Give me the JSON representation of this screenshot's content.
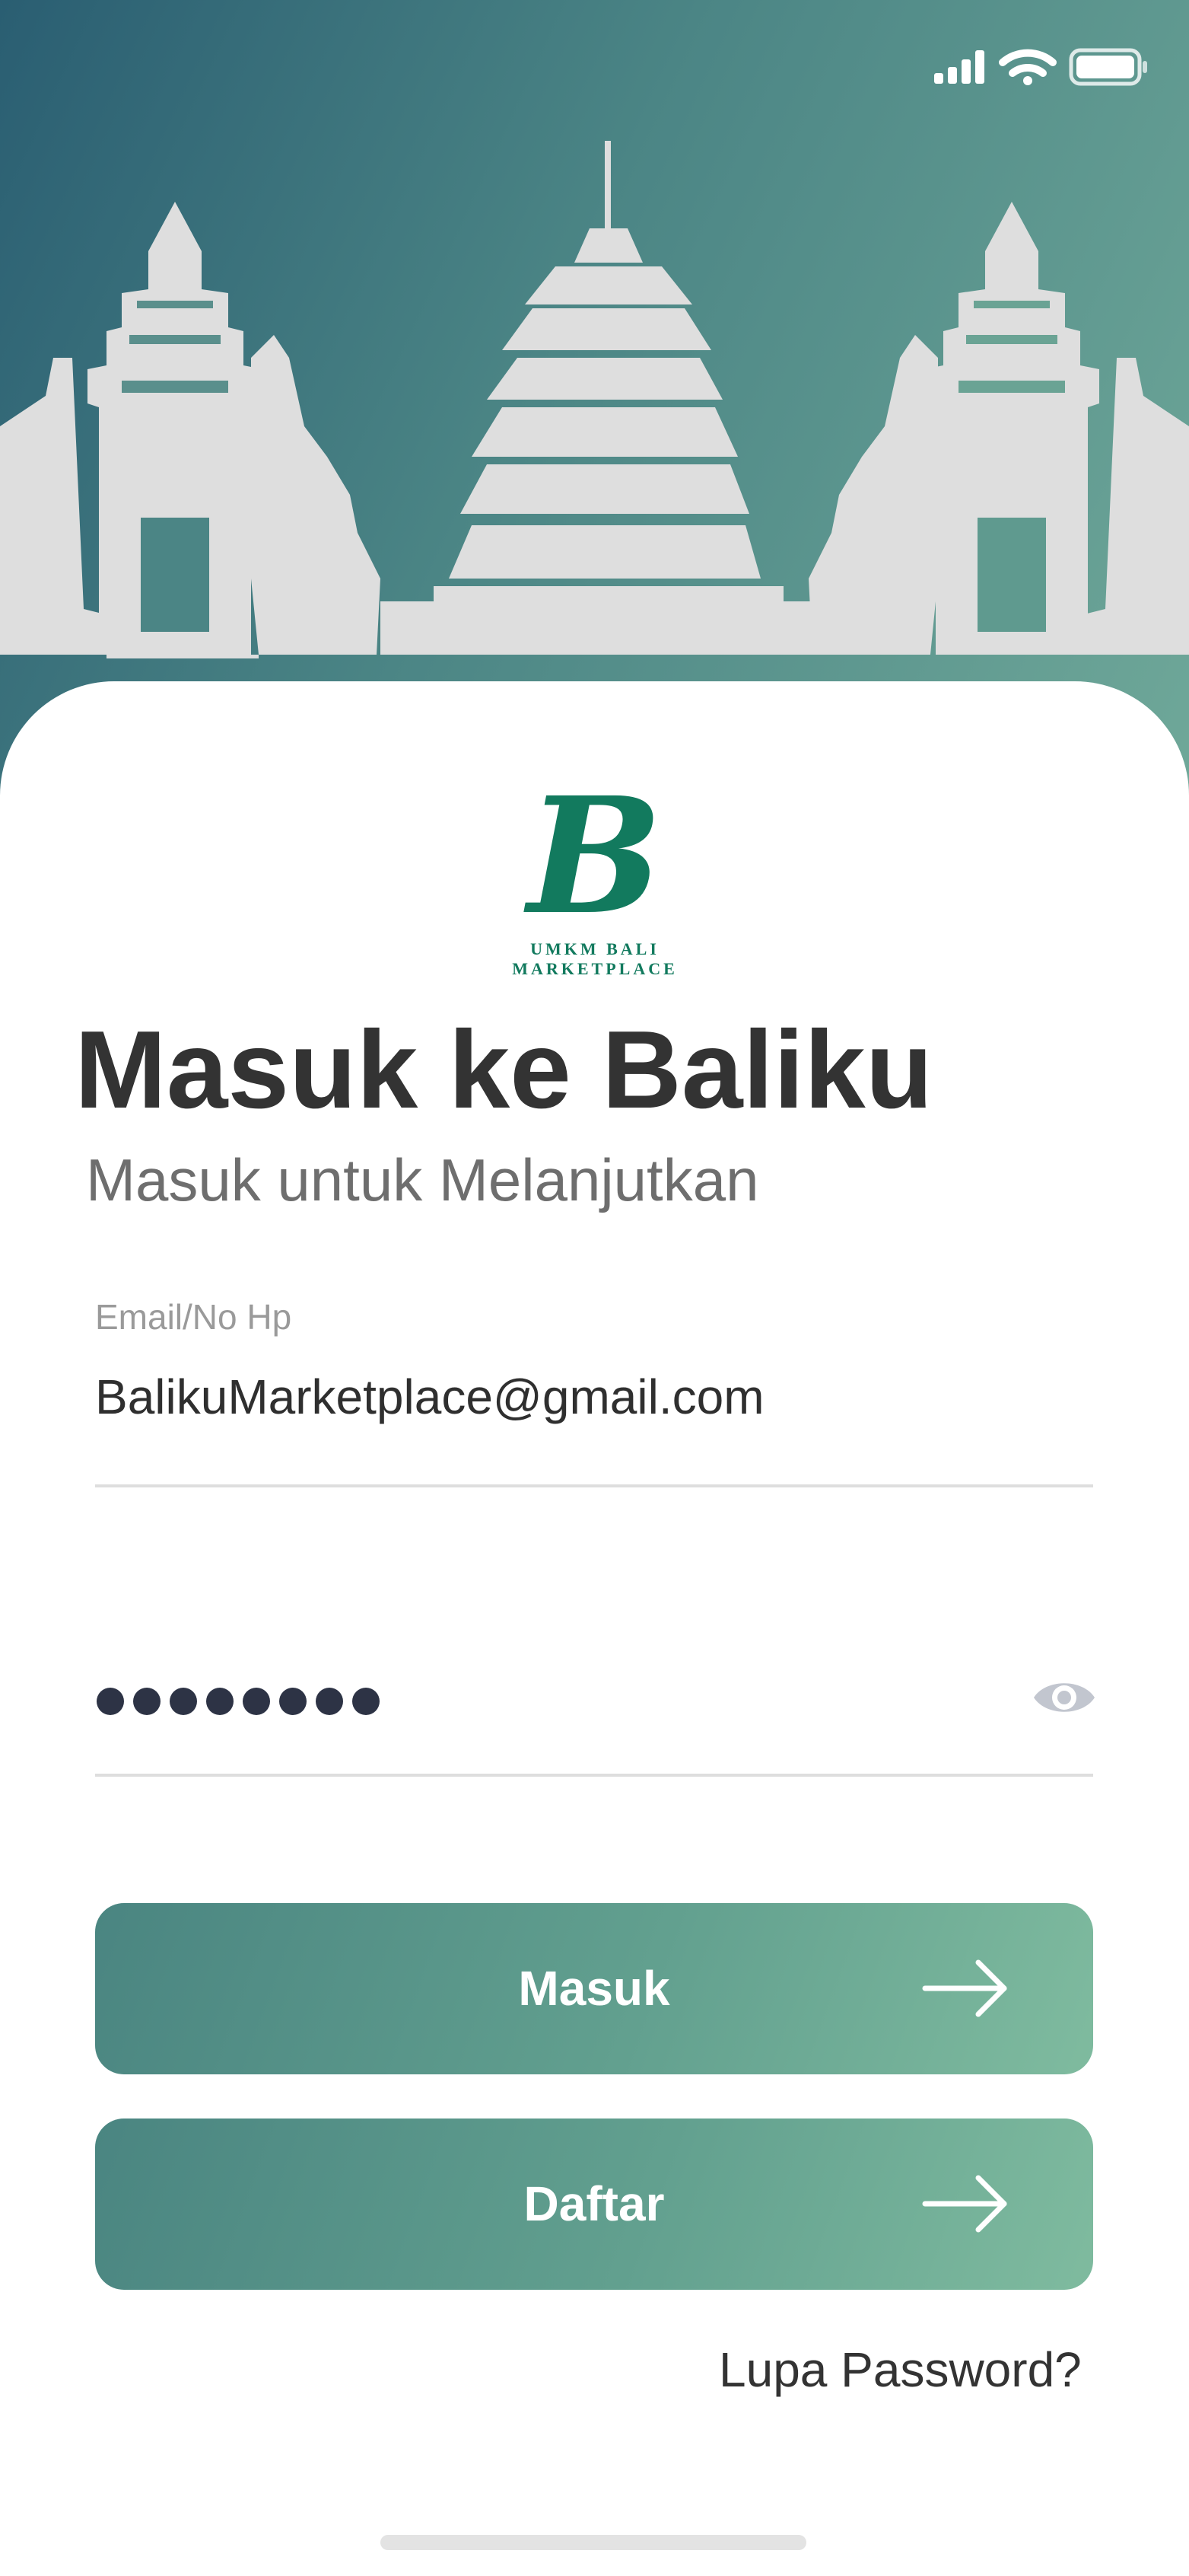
{
  "logo": {
    "letter": "B",
    "caption": "UMKM BALI MARKETPLACE",
    "color": "#127a5e"
  },
  "header": {
    "title": "Masuk ke Baliku",
    "subtitle": "Masuk untuk Melanjutkan"
  },
  "form": {
    "email": {
      "label": "Email/No Hp",
      "value": "BalikuMarketplace@gmail.com"
    },
    "password": {
      "masked_value": "••••••••",
      "visibility_icon": "eye-icon"
    }
  },
  "buttons": {
    "login_label": "Masuk",
    "register_label": "Daftar",
    "arrow_icon": "arrow-right-icon"
  },
  "links": {
    "forgot_password": "Lupa Password?"
  },
  "status_bar": {
    "icons": [
      "signal-icon",
      "wifi-icon",
      "battery-icon"
    ]
  },
  "colors": {
    "hero_gradient_start": "#2a5e72",
    "hero_gradient_end": "#6fa899",
    "brand": "#127a5e",
    "button_gradient_start": "#4a8581",
    "button_gradient_end": "#7fbb9f"
  }
}
